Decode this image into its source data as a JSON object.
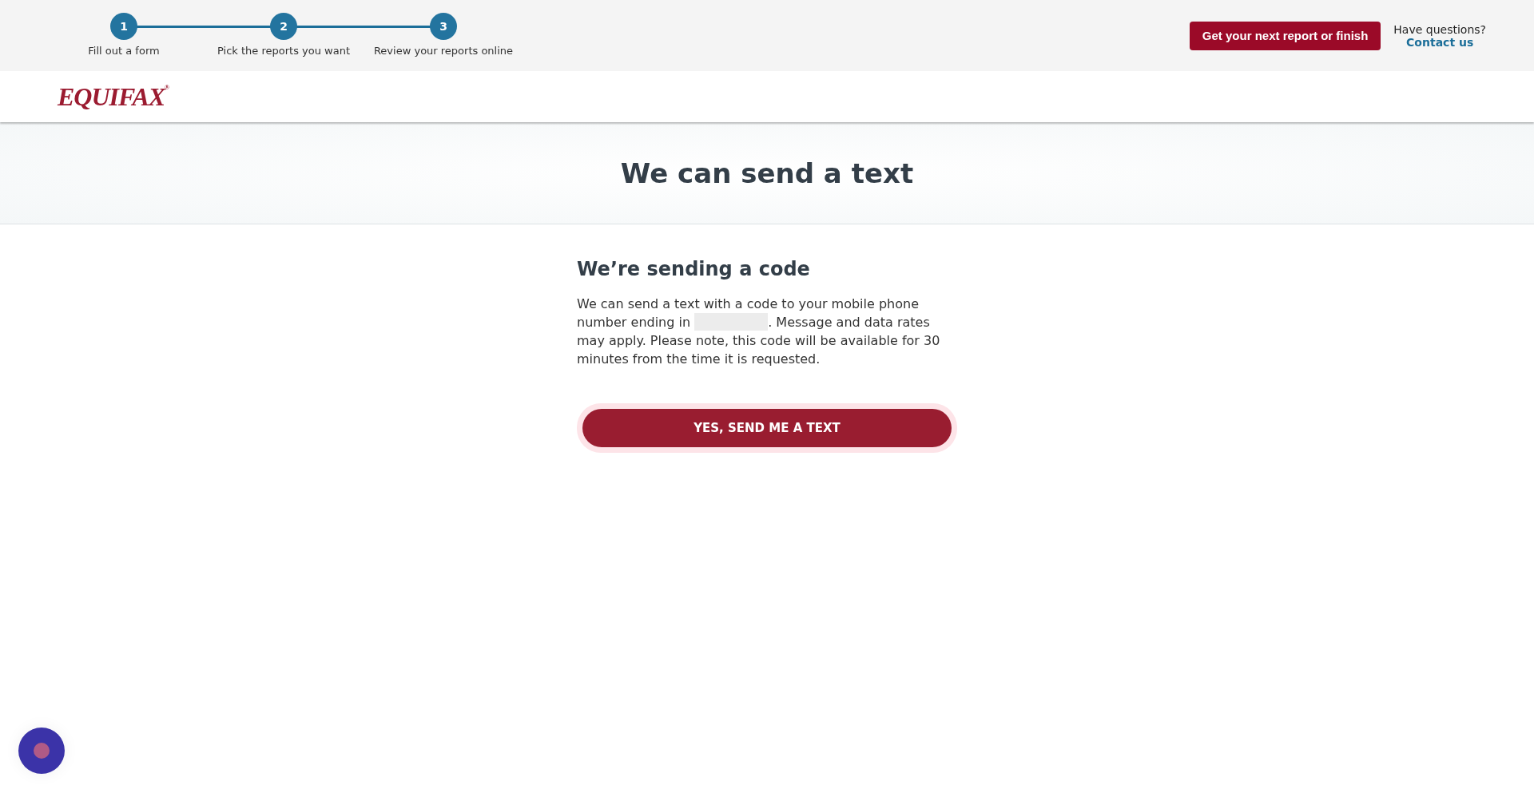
{
  "progress_steps": [
    {
      "number": "1",
      "label": "Fill out a form"
    },
    {
      "number": "2",
      "label": "Pick the reports you want"
    },
    {
      "number": "3",
      "label": "Review your reports online"
    }
  ],
  "next_report_button": "Get your next report or finish",
  "help": {
    "question": "Have questions?",
    "link": "Contact us"
  },
  "logo": "EQUIFAX$^{®}$",
  "hero_title": "We can send a text",
  "section": {
    "heading": "We’re sending a code",
    "text_before": "We can send a text with a code to your mobile phone number ending in",
    "text_after": ". Message and data rates may apply. Please note, this code will be available for 30 minutes from the time it is requested.",
    "button": "YES, SEND ME A TEXT"
  }
}
